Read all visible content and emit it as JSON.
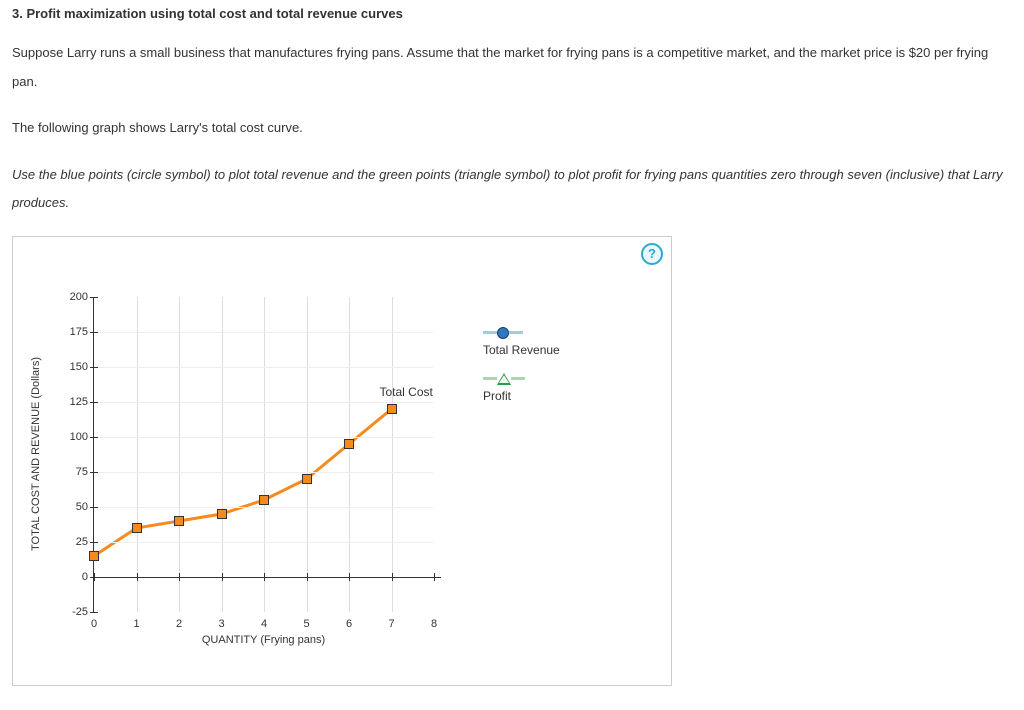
{
  "heading": "3. Profit maximization using total cost and total revenue curves",
  "para1": "Suppose Larry runs a small business that manufactures frying pans. Assume that the market for frying pans is a competitive market, and the market price is $20 per frying pan.",
  "para2": "The following graph shows Larry's total cost curve.",
  "para3": "Use the blue points (circle symbol) to plot total revenue and the green points (triangle symbol) to plot profit for frying pans quantities zero through seven (inclusive) that Larry produces.",
  "help": "?",
  "legend": {
    "tr": "Total Revenue",
    "profit": "Profit"
  },
  "series_label_tc": "Total Cost",
  "axis": {
    "x": "QUANTITY (Frying pans)",
    "y": "TOTAL COST AND REVENUE (Dollars)"
  },
  "chart_data": {
    "type": "line",
    "xlabel": "QUANTITY (Frying pans)",
    "ylabel": "TOTAL COST AND REVENUE (Dollars)",
    "xlim": [
      0,
      8
    ],
    "ylim": [
      -25,
      200
    ],
    "x_ticks": [
      0,
      1,
      2,
      3,
      4,
      5,
      6,
      7,
      8
    ],
    "y_ticks": [
      -25,
      0,
      25,
      50,
      75,
      100,
      125,
      150,
      175,
      200
    ],
    "series": [
      {
        "name": "Total Cost",
        "x": [
          0,
          1,
          2,
          3,
          4,
          5,
          6,
          7
        ],
        "values": [
          15,
          35,
          40,
          45,
          55,
          70,
          95,
          120
        ],
        "color": "#f58a1f",
        "marker": "square"
      }
    ],
    "draggable_series": [
      {
        "name": "Total Revenue",
        "marker": "circle",
        "color": "#2f76c3"
      },
      {
        "name": "Profit",
        "marker": "triangle",
        "color": "#2e9a47"
      }
    ]
  }
}
